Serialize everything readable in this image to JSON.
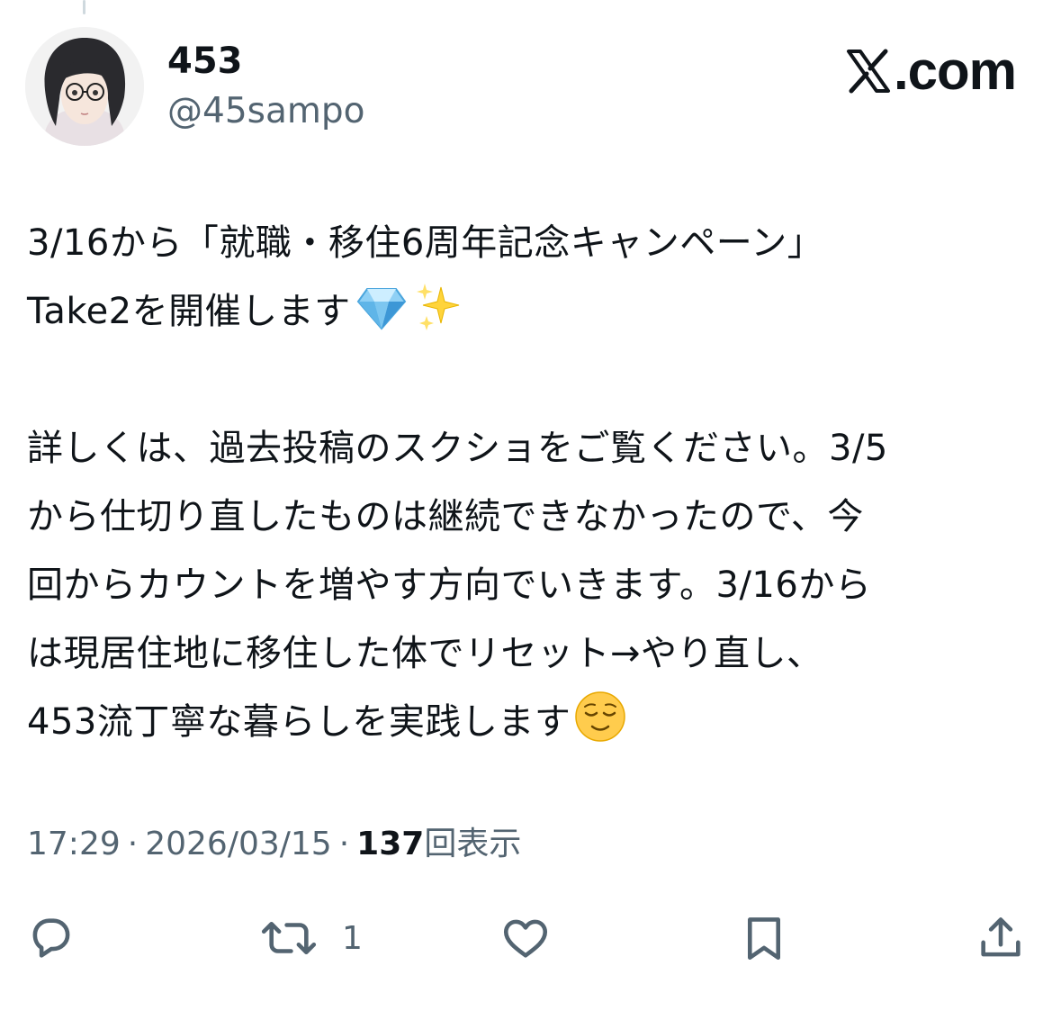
{
  "header": {
    "display_name": "453",
    "handle": "@45sampo",
    "brand_text": ".com",
    "brand_icon": "x-logo-icon"
  },
  "tweet": {
    "line1": "3/16から「就職・移住6周年記念キャンペーン」",
    "line2": "Take2を開催します",
    "line2_emojis": [
      "gem-icon",
      "sparkles-icon"
    ],
    "line3": "詳しくは、過去投稿のスクショをご覧ください。3/5",
    "line4": "から仕切り直したものは継続できなかったので、今",
    "line5": "回からカウントを増やす方向でいきます。3/16から",
    "line6": "は現居住地に移住した体でリセット→やり直し、",
    "line7": "453流丁寧な暮らしを実践します",
    "line7_emoji": "relieved-face-icon"
  },
  "meta": {
    "time": "17:29",
    "separator": "·",
    "date": "2026/03/15",
    "views_count": "137",
    "views_label": "回表示"
  },
  "actions": {
    "reply": {
      "icon": "reply-icon",
      "count": ""
    },
    "retweet": {
      "icon": "retweet-icon",
      "count": "1"
    },
    "like": {
      "icon": "heart-icon",
      "count": ""
    },
    "bookmark": {
      "icon": "bookmark-icon",
      "count": ""
    },
    "share": {
      "icon": "share-icon",
      "count": ""
    }
  },
  "colors": {
    "text_primary": "#0f1419",
    "text_secondary": "#536471",
    "background": "#ffffff"
  }
}
